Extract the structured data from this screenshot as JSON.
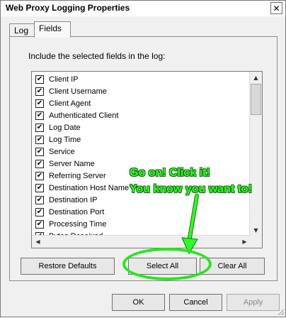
{
  "window": {
    "title": "Web Proxy Logging Properties",
    "close_glyph": "✕"
  },
  "tabs": [
    {
      "label": "Log"
    },
    {
      "label": "Fields"
    }
  ],
  "panel": {
    "caption": "Include the selected fields in the log:"
  },
  "fields": [
    {
      "label": "Client IP",
      "checked": true
    },
    {
      "label": "Client Username",
      "checked": true
    },
    {
      "label": "Client Agent",
      "checked": true
    },
    {
      "label": "Authenticated Client",
      "checked": true
    },
    {
      "label": "Log Date",
      "checked": true
    },
    {
      "label": "Log Time",
      "checked": true
    },
    {
      "label": "Service",
      "checked": true
    },
    {
      "label": "Server Name",
      "checked": true
    },
    {
      "label": "Referring Server",
      "checked": true
    },
    {
      "label": "Destination Host Name",
      "checked": true
    },
    {
      "label": "Destination IP",
      "checked": true
    },
    {
      "label": "Destination Port",
      "checked": true
    },
    {
      "label": "Processing Time",
      "checked": true
    },
    {
      "label": "Bytes Received",
      "checked": true
    }
  ],
  "check_glyph": "✔",
  "buttons": {
    "restore_defaults": "Restore Defaults",
    "select_all": "Select All",
    "clear_all": "Clear All",
    "ok": "OK",
    "cancel": "Cancel",
    "apply": "Apply"
  },
  "annotation": {
    "line1": "Go on! Click it!",
    "line2": "You know you want to!",
    "color": "#2aff22"
  }
}
